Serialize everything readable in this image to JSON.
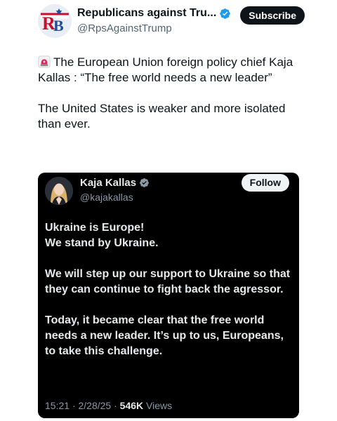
{
  "post": {
    "author_name": "Republicans against Tru...",
    "author_handle": "@RpsAgainstTrump",
    "subscribe_label": "Subscribe",
    "paragraph1": "The European Union foreign policy chief Kaja Kallas : “The free world needs a new leader”",
    "paragraph2": "The United States is weaker and more isolated than ever."
  },
  "quoted": {
    "author_name": "Kaja Kallas",
    "author_handle": "@kajakallas",
    "follow_label": "Follow",
    "line1": "Ukraine is Europe!",
    "line2": "We stand by Ukraine.",
    "paragraph2": "We will step up our support to Ukraine so that they can continue to fight back the agressor.",
    "paragraph3": "Today, it became clear that the free world needs a new leader. It’s up to us, Europeans, to take this challenge.",
    "time": "15:21",
    "separator": "·",
    "date": "2/28/25",
    "views_count": "546K",
    "views_label": "Views"
  },
  "icons": {
    "verified": "verified-badge-icon",
    "siren": "siren-emoji-icon",
    "logo": "rb-logo"
  },
  "logo": {
    "text": "RB"
  },
  "colors": {
    "verified_blue": "#1d9bf0",
    "quote_bg": "#000000",
    "logo_red": "#c8102e",
    "logo_blue": "#1f4f9c"
  }
}
